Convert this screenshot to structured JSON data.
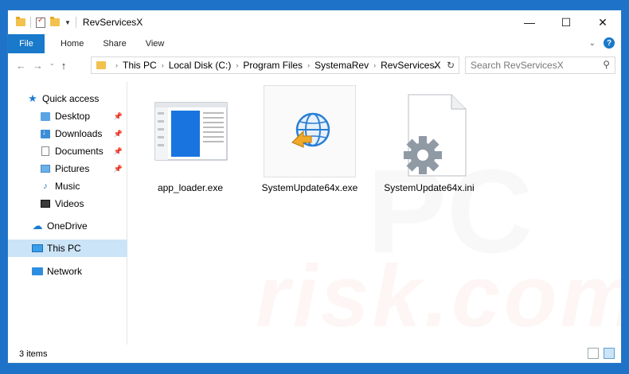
{
  "window": {
    "title": "RevServicesX"
  },
  "window_controls": {
    "minimize": "—",
    "maximize": "☐",
    "close": "✕"
  },
  "ribbon": {
    "file": "File",
    "tabs": [
      "Home",
      "Share",
      "View"
    ]
  },
  "address": {
    "crumbs": [
      "This PC",
      "Local Disk (C:)",
      "Program Files",
      "SystemaRev",
      "RevServicesX"
    ]
  },
  "search": {
    "placeholder": "Search RevServicesX"
  },
  "nav": {
    "quick_access": "Quick access",
    "items": [
      "Desktop",
      "Downloads",
      "Documents",
      "Pictures",
      "Music",
      "Videos"
    ],
    "onedrive": "OneDrive",
    "this_pc": "This PC",
    "network": "Network"
  },
  "files": [
    {
      "name": "app_loader.exe",
      "icon": "app-window-icon"
    },
    {
      "name": "SystemUpdate64x.exe",
      "icon": "globe-arrow-icon"
    },
    {
      "name": "SystemUpdate64x.ini",
      "icon": "gear-file-icon"
    }
  ],
  "status": {
    "count": "3 items"
  },
  "watermark": {
    "text": "risk.com"
  }
}
